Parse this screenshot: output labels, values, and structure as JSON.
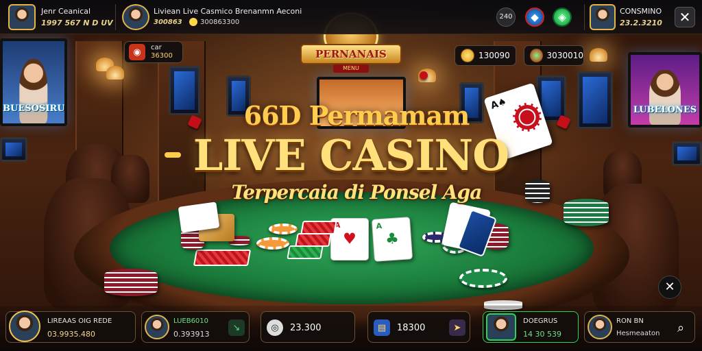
{
  "topbar": {
    "player1": {
      "name": "Jenr Ceanical",
      "stats": "1997 567 N D UV"
    },
    "player2": {
      "name": "Liviean Live Casmico Brenanmn Aeconi",
      "stats": "300863",
      "coins": "300863300"
    },
    "right_round_label": "240",
    "player3": {
      "name": "CONSMINO",
      "balance": "23.2.3210"
    }
  },
  "hud": {
    "left_chip_label": "car",
    "left_chip_value": "36300",
    "gold_value": "130090",
    "gem_value": "3030010"
  },
  "logo": {
    "title": "PERNANAIS",
    "sub": "MENU"
  },
  "tv_left": {
    "text": "BUESOSIRUS"
  },
  "tv_right": {
    "text": "LUBELONES"
  },
  "promo": {
    "line1": "66D Permamam",
    "line2": "LIVE CASINO",
    "line3": "Terpercaia di Ponsel Aga"
  },
  "cards": [
    {
      "rank": "A",
      "suit": "♥",
      "color": "#d0101e"
    },
    {
      "rank": "A",
      "suit": "♣",
      "color": "#1b8a3a"
    }
  ],
  "flying_card": {
    "rank": "A♠"
  },
  "bottombar": {
    "b1": {
      "title": "LIREAAS OIG REDE",
      "value": "03.9935.480"
    },
    "b2": {
      "title": "LUEB6010",
      "value": "0.393913"
    },
    "b3": {
      "value": "23.300"
    },
    "b4": {
      "value": "18300"
    },
    "b5": {
      "title": "DOEGRUS",
      "value": "14 30 539"
    },
    "b6": {
      "title": "RON BN",
      "value": "Hesmeaaton"
    }
  },
  "icons": {
    "close": "✕",
    "search": "⌕",
    "arrow": "➤",
    "diag": "↘"
  },
  "colors": {
    "gold": "#ffcc4d",
    "felt": "#1a7b3b",
    "accent_green": "#2fd35a"
  }
}
